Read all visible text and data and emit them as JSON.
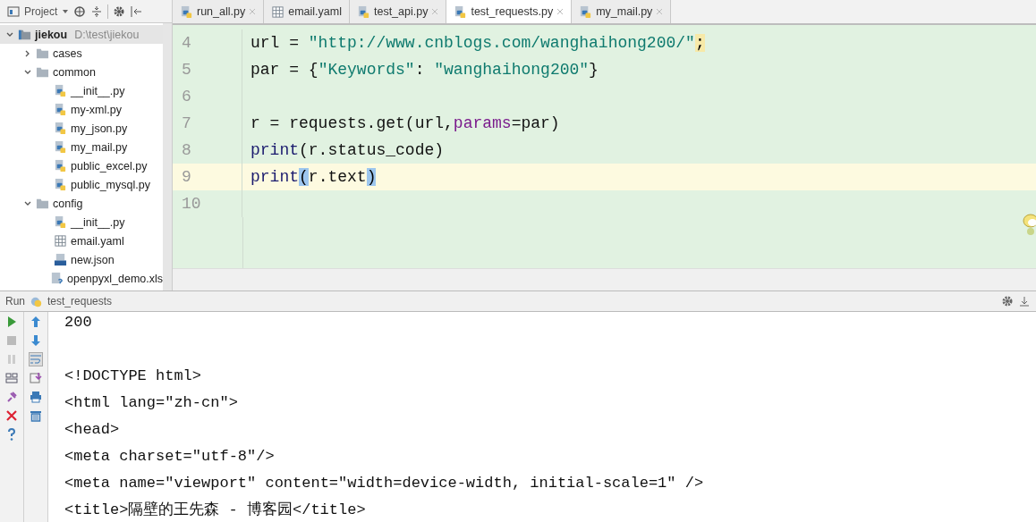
{
  "project_toolbar": {
    "label": "Project"
  },
  "tabs": [
    {
      "label": "run_all.py",
      "kind": "python",
      "selected": false
    },
    {
      "label": "email.yaml",
      "kind": "yaml",
      "selected": false
    },
    {
      "label": "test_api.py",
      "kind": "python",
      "selected": false
    },
    {
      "label": "test_requests.py",
      "kind": "python",
      "selected": true
    },
    {
      "label": "my_mail.py",
      "kind": "python",
      "selected": false
    }
  ],
  "tree": [
    {
      "name": "jiekou",
      "path": "D:\\test\\jiekou",
      "kind": "module",
      "expanded": true,
      "selected": true,
      "children": [
        {
          "name": "cases",
          "kind": "folder",
          "expanded": false,
          "selected": false
        },
        {
          "name": "common",
          "kind": "folder",
          "expanded": true,
          "selected": false,
          "children": [
            {
              "name": "__init__.py",
              "kind": "python",
              "selected": false
            },
            {
              "name": "my-xml.py",
              "kind": "python",
              "selected": false
            },
            {
              "name": "my_json.py",
              "kind": "python",
              "selected": false
            },
            {
              "name": "my_mail.py",
              "kind": "python",
              "selected": false
            },
            {
              "name": "public_excel.py",
              "kind": "python",
              "selected": false
            },
            {
              "name": "public_mysql.py",
              "kind": "python",
              "selected": false
            }
          ]
        },
        {
          "name": "config",
          "kind": "folder",
          "expanded": true,
          "selected": false,
          "children": [
            {
              "name": "__init__.py",
              "kind": "python",
              "selected": false
            },
            {
              "name": "email.yaml",
              "kind": "yaml",
              "selected": false
            },
            {
              "name": "new.json",
              "kind": "json",
              "selected": false
            },
            {
              "name": "openpyxl_demo.xls",
              "kind": "unknown",
              "selected": false
            }
          ]
        }
      ]
    }
  ],
  "editor": {
    "lines": [
      {
        "number": "4",
        "current": false,
        "tokens": [
          {
            "kind": "plain",
            "text": "url = "
          },
          {
            "kind": "string",
            "text": "\"http://www.cnblogs.com/wanghaihong200/\""
          },
          {
            "kind": "warning",
            "text": ";"
          }
        ]
      },
      {
        "number": "5",
        "current": false,
        "tokens": [
          {
            "kind": "plain",
            "text": "par = {"
          },
          {
            "kind": "string",
            "text": "\"Keywords\""
          },
          {
            "kind": "plain",
            "text": ": "
          },
          {
            "kind": "string",
            "text": "\"wanghaihong200\""
          },
          {
            "kind": "plain",
            "text": "}"
          }
        ]
      },
      {
        "number": "6",
        "current": false
      },
      {
        "number": "7",
        "current": false,
        "tokens": [
          {
            "kind": "plain",
            "text": "r = requests.get(url,"
          },
          {
            "kind": "param",
            "text": "params"
          },
          {
            "kind": "plain",
            "text": "=par)"
          }
        ]
      },
      {
        "number": "8",
        "current": false,
        "tokens": [
          {
            "kind": "builtin",
            "text": "print"
          },
          {
            "kind": "plain",
            "text": "(r.status_code)"
          }
        ]
      },
      {
        "number": "9",
        "current": true,
        "tokens": [
          {
            "kind": "builtin",
            "text": "print"
          },
          {
            "kind": "match",
            "text": "("
          },
          {
            "kind": "plain",
            "text": "r.text"
          },
          {
            "kind": "match",
            "text": ")"
          }
        ]
      },
      {
        "number": "10",
        "current": false
      }
    ]
  },
  "run_panel": {
    "label": "Run",
    "config": "test_requests"
  },
  "console": {
    "blocks": [
      [
        "200"
      ],
      [
        "<!DOCTYPE html>",
        "<html lang=\"zh-cn\">",
        "<head>",
        "<meta charset=\"utf-8\"/>",
        "<meta name=\"viewport\" content=\"width=device-width, initial-scale=1\" />",
        "<title>隔壁的王先森 - 博客园</title>"
      ]
    ]
  }
}
